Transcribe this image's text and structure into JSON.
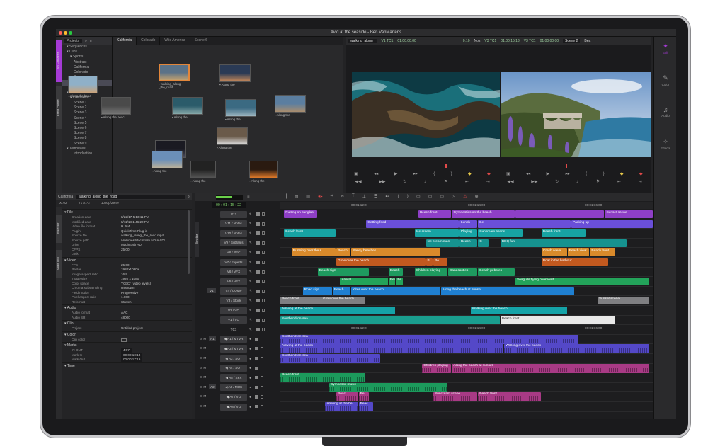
{
  "window": {
    "title": "Avid at the seaside - Ben VanMartens"
  },
  "project_panel": {
    "selector": "Projects",
    "side_tabs": [
      "Bin Container",
      "Effect Palette"
    ],
    "tree": [
      {
        "label": "Sequences",
        "depth": 1
      },
      {
        "label": "Clips",
        "depth": 1
      },
      {
        "label": "Sports",
        "depth": 2
      },
      {
        "label": "Abstract",
        "depth": 3
      },
      {
        "label": "California",
        "depth": 3
      },
      {
        "label": "Colorado",
        "depth": 3
      },
      {
        "label": "Cowboy",
        "depth": 3
      },
      {
        "label": "Equinox",
        "depth": 3,
        "selected": true
      },
      {
        "label": "Wild America",
        "depth": 3
      },
      {
        "label": "Scenes",
        "depth": 1
      },
      {
        "label": "Out-takes",
        "depth": 2
      },
      {
        "label": "Scene 1",
        "depth": 3
      },
      {
        "label": "Scene 2",
        "depth": 3
      },
      {
        "label": "Scene 3",
        "depth": 3
      },
      {
        "label": "Scene 4",
        "depth": 3
      },
      {
        "label": "Scene 5",
        "depth": 3
      },
      {
        "label": "Scene 6",
        "depth": 3
      },
      {
        "label": "Scene 7",
        "depth": 3
      },
      {
        "label": "Scene 8",
        "depth": 3
      },
      {
        "label": "Scene 9",
        "depth": 3
      },
      {
        "label": "Templates",
        "depth": 1
      },
      {
        "label": "Introduction",
        "depth": 3
      }
    ]
  },
  "bin": {
    "tabs": [
      "California",
      "Colorado",
      "Wild America",
      "Scene 6"
    ],
    "active_tab": 0,
    "clips": [
      {
        "label": "Along the beac",
        "tone": "beach"
      },
      {
        "label": "walking_along _the_road",
        "tone": "road",
        "selected": true
      },
      {
        "label": "Along the beac",
        "tone": "rocks"
      },
      {
        "label": "Along the",
        "tone": "sunset"
      },
      {
        "label": "Along the",
        "tone": "coast"
      },
      {
        "label": "Along the",
        "tone": "aerial"
      },
      {
        "label": "Along the",
        "tone": "cliff"
      },
      {
        "label": "Along the",
        "tone": "night"
      },
      {
        "label": "Along the",
        "tone": "people"
      },
      {
        "label": "Along the",
        "tone": "bridge"
      },
      {
        "label": "Along the",
        "tone": "dark"
      },
      {
        "label": "Along the",
        "tone": "fire"
      }
    ]
  },
  "player": {
    "source_clip": "walking_along_",
    "source_track": "V1 TC1",
    "source_tc": "01:00:00:00",
    "mid_value": "0:10",
    "record_track": "V3 TC1",
    "record_label": "Nos",
    "record_tc1": "01:00:15:13",
    "record_tc2": "01:00:00:00",
    "sequence": "Scene 2",
    "sequence_extra": "Bea"
  },
  "right_rail": [
    {
      "label": "Edit",
      "icon": "edit-icon",
      "glyph": "✦",
      "active": true
    },
    {
      "label": "Color",
      "icon": "color-icon",
      "glyph": "✎"
    },
    {
      "label": "Audio",
      "icon": "audio-icon",
      "glyph": "♫"
    },
    {
      "label": "Effects",
      "icon": "effects-icon",
      "glyph": "✧"
    }
  ],
  "inspector": {
    "bin_name": "California",
    "clip_name": "walking_along_the_road",
    "summary": {
      "duration": "00:02",
      "tracks": "V1 A1-2",
      "format": "1080p/29.97"
    },
    "side_tabs": [
      "Inspector",
      "Audio Tool"
    ],
    "sections": [
      {
        "name": "File",
        "rows": [
          [
            "Creation date",
            "8/22/17    5:13:11 PM"
          ],
          [
            "Modified date",
            "8/11/18    1:46:22 PM"
          ],
          [
            "Video file format",
            "H.264"
          ],
          [
            "Plugin",
            "QuickTime Plug-in"
          ],
          [
            "Source file",
            "walking_along_the_road.mp4"
          ],
          [
            "Source path",
            "/Volumes/Macintosh HD/AVID/"
          ],
          [
            "Drive",
            "Macintosh HD"
          ],
          [
            "CFPS",
            "25.00"
          ],
          [
            "Lock",
            ""
          ]
        ]
      },
      {
        "name": "Video",
        "rows": [
          [
            "FPS",
            "25.00"
          ],
          [
            "Raster",
            "1920x1080a"
          ],
          [
            "Image aspect ratio",
            "16:9"
          ],
          [
            "Image size",
            "1920 x 1080"
          ],
          [
            "Color space",
            "YCbCr (video levels)"
          ],
          [
            "Chroma subsampling",
            "unknown"
          ],
          [
            "Field motion",
            "Progressive"
          ],
          [
            "Pixel aspect ratio",
            "1.000"
          ],
          [
            "Reformat",
            "Stretch"
          ]
        ]
      },
      {
        "name": "Audio",
        "rows": [
          [
            "Audio format",
            "AAC"
          ],
          [
            "Audio SR",
            "48000"
          ]
        ]
      },
      {
        "name": "Clip",
        "rows": [
          [
            "Project",
            "Untitled project"
          ]
        ]
      },
      {
        "name": "Color",
        "rows": [
          [
            "Clip color",
            ""
          ]
        ]
      },
      {
        "name": "Marks",
        "rows": [
          [
            "IN-OUT",
            "4:07"
          ],
          [
            "Mark In",
            "00:00:10:13"
          ],
          [
            "Mark Out",
            "00:00:17:19"
          ]
        ]
      },
      {
        "name": "Time",
        "rows": []
      }
    ]
  },
  "timeline": {
    "timecode": "00 : 01 : 15 : 22",
    "side_tab": "Timeline",
    "ruler_marks": [
      "00:01:12:0",
      "00:01:14:00",
      "00:01:16:00"
    ],
    "audio_ruler_marks": [
      "00:01:12:0",
      "00:01:14:00",
      "00:01:16:00"
    ],
    "video_tracks": [
      {
        "name": "V12",
        "top": 0,
        "clips": [
          {
            "label": "Putting on sunglas",
            "start": 0.01,
            "end": 0.1,
            "color": "#8e3fc6"
          },
          {
            "label": "Beach front",
            "start": 0.37,
            "end": 0.46,
            "color": "#8e3fc6"
          },
          {
            "label": "Gymnastics on the beach",
            "start": 0.46,
            "end": 0.63,
            "color": "#8e3fc6"
          },
          {
            "label": "",
            "start": 0.63,
            "end": 0.87,
            "color": "#8e3fc6"
          },
          {
            "label": "Sunset scene",
            "start": 0.87,
            "end": 1.0,
            "color": "#8e3fc6"
          }
        ]
      },
      {
        "name": "V11 / Notes",
        "clips": [
          {
            "label": "Getting food",
            "start": 0.23,
            "end": 0.48,
            "color": "#6a4fd8"
          },
          {
            "label": "Lunch",
            "start": 0.48,
            "end": 0.53,
            "color": "#6a4fd8"
          },
          {
            "label": "Be",
            "start": 0.53,
            "end": 0.78,
            "color": "#6a4fd8"
          },
          {
            "label": "Parking up",
            "start": 0.78,
            "end": 1.0,
            "color": "#6a4fd8"
          }
        ]
      },
      {
        "name": "V10 / Notes",
        "clips": [
          {
            "label": "Beach front",
            "start": 0.01,
            "end": 0.15,
            "color": "#17a3a3"
          },
          {
            "label": "Ice cream",
            "start": 0.36,
            "end": 0.48,
            "color": "#17a3a3"
          },
          {
            "label": "Playing",
            "start": 0.48,
            "end": 0.53,
            "color": "#17a3a3"
          },
          {
            "label": "Suncream scene",
            "start": 0.53,
            "end": 0.65,
            "color": "#17a3a3"
          },
          {
            "label": "Beach front",
            "start": 0.7,
            "end": 0.82,
            "color": "#17a3a3"
          }
        ]
      },
      {
        "name": "V9 / Subtitles",
        "clips": [
          {
            "label": "Ice cream man",
            "start": 0.39,
            "end": 0.48,
            "color": "#16928f"
          },
          {
            "label": "Beach",
            "start": 0.48,
            "end": 0.53,
            "color": "#16928f"
          },
          {
            "label": "C",
            "start": 0.53,
            "end": 0.56,
            "color": "#16928f"
          },
          {
            "label": "BBQ fun",
            "start": 0.59,
            "end": 0.93,
            "color": "#16928f"
          }
        ]
      },
      {
        "name": "V8 / REC",
        "clips": [
          {
            "label": "Running over the s",
            "start": 0.03,
            "end": 0.15,
            "color": "#d98a2b"
          },
          {
            "label": "Beach",
            "start": 0.15,
            "end": 0.19,
            "color": "#d98a2b"
          },
          {
            "label": "Sandy beaches",
            "start": 0.19,
            "end": 0.43,
            "color": "#d98a2b"
          },
          {
            "label": "Crash wave",
            "start": 0.7,
            "end": 0.77,
            "color": "#d98a2b"
          },
          {
            "label": "Beach view",
            "start": 0.77,
            "end": 0.83,
            "color": "#d98a2b"
          },
          {
            "label": "Beach front",
            "start": 0.83,
            "end": 0.9,
            "color": "#d98a2b"
          }
        ]
      },
      {
        "name": "V7 / Experts",
        "clips": [
          {
            "label": "Glow over the beach",
            "start": 0.15,
            "end": 0.39,
            "color": "#c2591f"
          },
          {
            "label": "B",
            "start": 0.39,
            "end": 0.41,
            "color": "#c2591f"
          },
          {
            "label": "Be",
            "start": 0.41,
            "end": 0.45,
            "color": "#c2591f"
          },
          {
            "label": "Boat in the harbour",
            "start": 0.7,
            "end": 0.88,
            "color": "#c2591f"
          }
        ]
      },
      {
        "name": "V6 / VFX",
        "clips": [
          {
            "label": "Beach sign",
            "start": 0.1,
            "end": 0.24,
            "color": "#1e9a5f"
          },
          {
            "label": "Beach",
            "start": 0.29,
            "end": 0.33,
            "color": "#1e9a5f"
          },
          {
            "label": "Children playing",
            "start": 0.36,
            "end": 0.45,
            "color": "#1e9a5f"
          },
          {
            "label": "Sandcastles",
            "start": 0.45,
            "end": 0.53,
            "color": "#1e9a5f"
          },
          {
            "label": "Beach pebbles",
            "start": 0.53,
            "end": 0.63,
            "color": "#1e9a5f"
          }
        ]
      },
      {
        "name": "V5 / VFX",
        "clips": [
          {
            "label": "Arrival",
            "start": 0.16,
            "end": 0.29,
            "color": "#23a35a"
          },
          {
            "label": "Beach",
            "start": 0.29,
            "end": 0.31,
            "color": "#23a35a"
          },
          {
            "label": "Be",
            "start": 0.31,
            "end": 0.33,
            "color": "#23a35a"
          },
          {
            "label": "Seagulls flying overhead",
            "start": 0.63,
            "end": 0.99,
            "color": "#23a35a"
          }
        ]
      },
      {
        "name": "V4 / COMP",
        "patch": "V1",
        "clips": [
          {
            "label": "Road sign",
            "start": 0.06,
            "end": 0.14,
            "color": "#1f7fd1"
          },
          {
            "label": "Beach",
            "start": 0.14,
            "end": 0.19,
            "color": "#1f7fd1"
          },
          {
            "label": "Kites over the beach",
            "start": 0.19,
            "end": 0.43,
            "color": "#1f7fd1"
          },
          {
            "label": "Along the beach at sunset",
            "start": 0.43,
            "end": 0.79,
            "color": "#1f7fd1"
          }
        ]
      },
      {
        "name": "V3 / Stock",
        "clips": [
          {
            "label": "Beach front",
            "start": 0.0,
            "end": 0.11,
            "color": "#7f7f82"
          },
          {
            "label": "Glow over the beach",
            "start": 0.11,
            "end": 0.23,
            "color": "#7f7f82"
          },
          {
            "label": "Sunset scene",
            "start": 0.85,
            "end": 0.99,
            "color": "#7f7f82"
          }
        ]
      },
      {
        "name": "V2 / VO",
        "clips": [
          {
            "label": "Arriving at the beach",
            "start": 0.0,
            "end": 0.31,
            "color": "#15a3a8"
          },
          {
            "label": "Walking over the beach",
            "start": 0.51,
            "end": 0.77,
            "color": "#15a3a8"
          }
        ]
      },
      {
        "name": "V1 / VO",
        "clips": [
          {
            "label": "Southend-on-sea",
            "start": 0.0,
            "end": 0.59,
            "color": "#1a9e8f"
          },
          {
            "label": "Beach front",
            "start": 0.59,
            "end": 0.9,
            "color": "#e8e8e8",
            "dark": true
          }
        ]
      },
      {
        "name": "TC1",
        "clips": []
      }
    ],
    "audio_tracks": [
      {
        "name": "◀ A1 / MTVR",
        "patch": "A1",
        "clips": [
          {
            "label": "Southend-on-sea",
            "start": 0.0,
            "end": 0.8,
            "color": "#5448c8"
          }
        ]
      },
      {
        "name": "◀ A2 / MTVR",
        "clips": [
          {
            "label": "Arriving at the beach",
            "start": 0.0,
            "end": 0.6,
            "color": "#5448c8"
          },
          {
            "label": "Walking over the beach",
            "start": 0.6,
            "end": 0.99,
            "color": "#5448c8"
          }
        ]
      },
      {
        "name": "◀ A3 / SOT",
        "clips": [
          {
            "label": "Southend-on-sea",
            "start": 0.0,
            "end": 0.27,
            "color": "#5448c8"
          }
        ]
      },
      {
        "name": "◀ A4 / SOT",
        "clips": [
          {
            "label": "Children playing",
            "start": 0.38,
            "end": 0.46,
            "color": "#a83a85"
          },
          {
            "label": "Along the beach at sunset",
            "start": 0.46,
            "end": 0.99,
            "color": "#a83a85"
          }
        ]
      },
      {
        "name": "◀ A5 / SFX",
        "clips": [
          {
            "label": "Beach front",
            "start": 0.0,
            "end": 0.23,
            "color": "#1c9a5c"
          }
        ]
      },
      {
        "name": "◀ A6 / MUS",
        "patch": "A2",
        "clips": [
          {
            "label": "Gymnastic music",
            "start": 0.13,
            "end": 0.45,
            "color": "#1c9a5c"
          }
        ]
      },
      {
        "name": "◀ A7 / VO",
        "clips": [
          {
            "label": "Beac",
            "start": 0.15,
            "end": 0.21,
            "color": "#a83a85"
          },
          {
            "label": "Be",
            "start": 0.21,
            "end": 0.24,
            "color": "#a83a85"
          },
          {
            "label": "Suncream scene",
            "start": 0.41,
            "end": 0.53,
            "color": "#a83a85"
          },
          {
            "label": "Beach front",
            "start": 0.53,
            "end": 0.7,
            "color": "#a83a85"
          }
        ]
      },
      {
        "name": "◀ A8 / VO",
        "clips": [
          {
            "label": "Arriving at the be",
            "start": 0.12,
            "end": 0.21,
            "color": "#5448c8"
          },
          {
            "label": "Beac",
            "start": 0.21,
            "end": 0.25,
            "color": "#5448c8"
          }
        ]
      }
    ],
    "playhead": 0.44
  },
  "colors": {
    "accent": "#a53ad6",
    "timecode": "#7fd06a"
  }
}
